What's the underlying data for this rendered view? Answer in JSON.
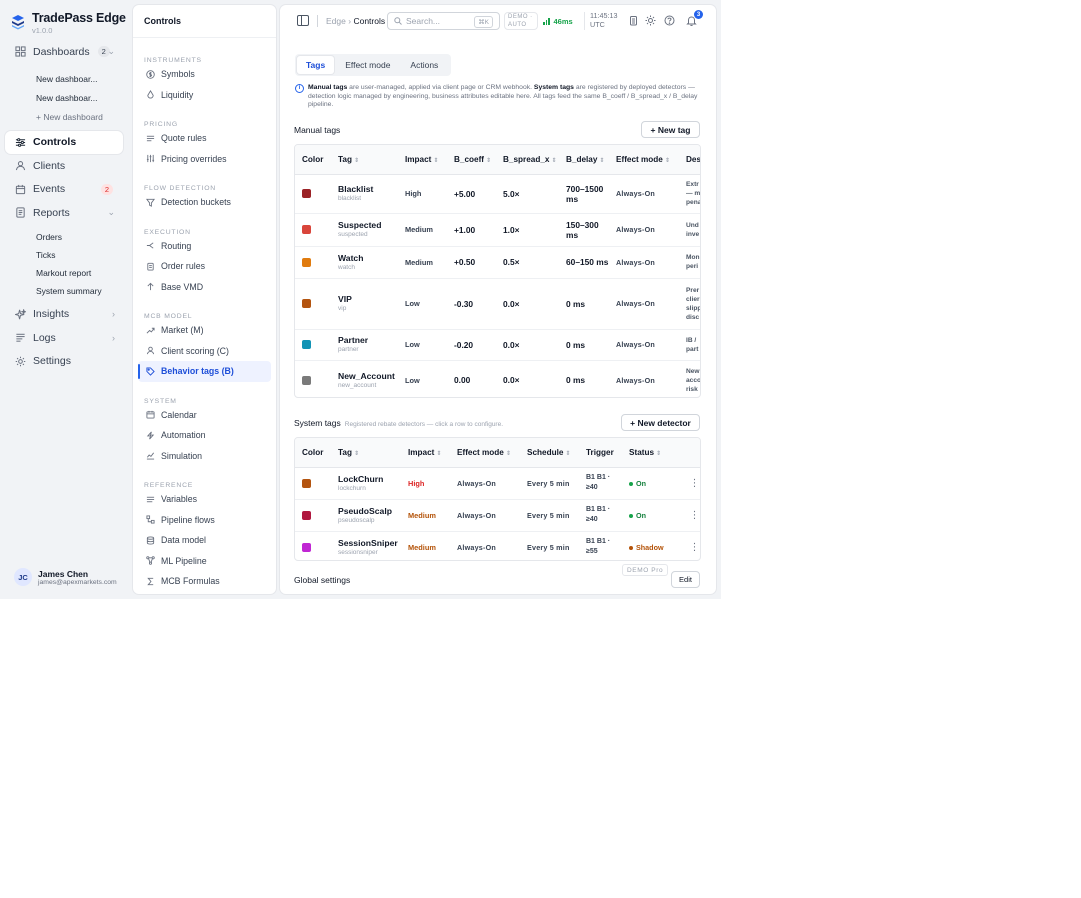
{
  "brand": {
    "name": "TradePass Edge",
    "version": "v1.0.0"
  },
  "nav": {
    "dashboards": {
      "label": "Dashboards",
      "count": "2"
    },
    "dashboard_items": [
      "New dashboar...",
      "New dashboar..."
    ],
    "new_dashboard": "+ New dashboard",
    "controls": "Controls",
    "clients": "Clients",
    "events": {
      "label": "Events",
      "count": "2"
    },
    "reports": "Reports",
    "report_items": [
      "Orders",
      "Ticks",
      "Markout report",
      "System summary"
    ],
    "insights": "Insights",
    "logs": "Logs",
    "settings": "Settings"
  },
  "user": {
    "initials": "JC",
    "name": "James Chen",
    "email": "james@apexmarkets.com"
  },
  "controls": {
    "title": "Controls",
    "sections": {
      "instruments": "INSTRUMENTS",
      "pricing": "PRICING",
      "flow_detection": "FLOW DETECTION",
      "execution": "EXECUTION",
      "mcb_model": "MCB MODEL",
      "system": "SYSTEM",
      "reference": "REFERENCE"
    },
    "items": {
      "symbols": "Symbols",
      "liquidity": "Liquidity",
      "quote_rules": "Quote rules",
      "pricing_overrides": "Pricing overrides",
      "detection_buckets": "Detection buckets",
      "routing": "Routing",
      "order_rules": "Order rules",
      "base_vmd": "Base VMD",
      "market_m": "Market (M)",
      "client_scoring": "Client scoring (C)",
      "behavior_tags": "Behavior tags (B)",
      "calendar": "Calendar",
      "automation": "Automation",
      "simulation": "Simulation",
      "variables": "Variables",
      "pipeline_flows": "Pipeline flows",
      "data_model": "Data model",
      "ml_pipeline": "ML Pipeline",
      "mcb_formulas": "MCB Formulas"
    }
  },
  "topbar": {
    "breadcrumb_root": "Edge",
    "breadcrumb_sep": "›",
    "breadcrumb_current": "Controls",
    "search_placeholder": "Search...",
    "search_shortcut": "⌘K",
    "env_line1": "DEMO ·",
    "env_line2": "AUTO",
    "latency": "46ms",
    "time": "11:45:13",
    "timezone": "UTC",
    "notifications": "3"
  },
  "tabs": [
    "Tags",
    "Effect mode",
    "Actions"
  ],
  "info": {
    "manual_bold": "Manual tags",
    "manual_text": " are user-managed, applied via client page or CRM webhook. ",
    "system_bold": "System tags",
    "system_text": " are registered by deployed detectors — detection logic managed by engineering, business attributes editable here. All tags feed the same B_coeff / B_spread_x / B_delay pipeline."
  },
  "manual": {
    "title": "Manual tags",
    "new_button": "+ New tag",
    "columns": [
      "Color",
      "Tag",
      "Impact",
      "B_coeff",
      "B_spread_x",
      "B_delay",
      "Effect mode",
      "Des"
    ],
    "rows": [
      {
        "color": "#9b2226",
        "name": "Blacklist",
        "slug": "blacklist",
        "impact": "High",
        "coeff": "+5.00",
        "spread": "5.0×",
        "delay": "700–1500 ms",
        "mode": "Always-On",
        "desc": [
          "Extr",
          "— m",
          "pena"
        ]
      },
      {
        "color": "#d9453b",
        "name": "Suspected",
        "slug": "suspected",
        "impact": "Medium",
        "coeff": "+1.00",
        "spread": "1.0×",
        "delay": "150–300 ms",
        "mode": "Always-On",
        "desc": [
          "Und",
          "inve"
        ]
      },
      {
        "color": "#e07b0f",
        "name": "Watch",
        "slug": "watch",
        "impact": "Medium",
        "coeff": "+0.50",
        "spread": "0.5×",
        "delay": "60–150 ms",
        "mode": "Always-On",
        "desc": [
          "Mon",
          "peri"
        ]
      },
      {
        "color": "#b3540f",
        "name": "VIP",
        "slug": "vip",
        "impact": "Low",
        "coeff": "-0.30",
        "spread": "0.0×",
        "delay": "0 ms",
        "mode": "Always-On",
        "desc": [
          "Prer",
          "clier",
          "slipp",
          "disc"
        ]
      },
      {
        "color": "#1293b5",
        "name": "Partner",
        "slug": "partner",
        "impact": "Low",
        "coeff": "-0.20",
        "spread": "0.0×",
        "delay": "0 ms",
        "mode": "Always-On",
        "desc": [
          "IB /",
          "part"
        ]
      },
      {
        "color": "#7a7a7a",
        "name": "New_Account",
        "slug": "new_account",
        "impact": "Low",
        "coeff": "0.00",
        "spread": "0.0×",
        "delay": "0 ms",
        "mode": "Always-On",
        "desc": [
          "New",
          "acco",
          "risk"
        ]
      }
    ]
  },
  "system": {
    "title": "System tags",
    "subtitle": "Registered rebate detectors — click a row to configure.",
    "new_button": "+ New detector",
    "columns": [
      "Color",
      "Tag",
      "Impact",
      "Effect mode",
      "Schedule",
      "Trigger",
      "Status"
    ],
    "rows": [
      {
        "color": "#b3540f",
        "name": "LockChurn",
        "slug": "lockchurn",
        "impact": "High",
        "mode": "Always-On",
        "schedule": "Every 5 min",
        "trigger": [
          "B1 B1 ·",
          "≥40"
        ],
        "status": "On"
      },
      {
        "color": "#b0173f",
        "name": "PseudoScalp",
        "slug": "pseudoscalp",
        "impact": "Medium",
        "mode": "Always-On",
        "schedule": "Every 5 min",
        "trigger": [
          "B1 B1 ·",
          "≥40"
        ],
        "status": "On"
      },
      {
        "color": "#c026d3",
        "name": "SessionSniper",
        "slug": "sessionsniper",
        "impact": "Medium",
        "mode": "Always-On",
        "schedule": "Every 5 min",
        "trigger": [
          "B1 B1 ·",
          "≥55"
        ],
        "status": "Shadow"
      }
    ]
  },
  "global": {
    "title": "Global settings",
    "edit_button": "Edit",
    "demo_badge": "DEMO Pro"
  },
  "colors": {
    "accent": "#2563eb",
    "high": "#dc2626",
    "medium": "#b45309",
    "on": "#15803d"
  }
}
